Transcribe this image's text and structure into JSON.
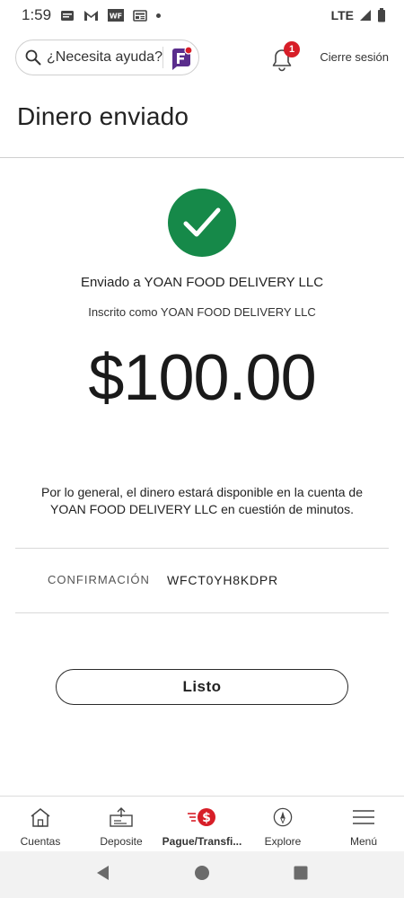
{
  "status_bar": {
    "time": "1:59",
    "network": "LTE",
    "notification_icons": [
      "message-icon",
      "gmail-icon",
      "wf-icon",
      "news-icon",
      "dot-icon"
    ]
  },
  "header": {
    "search_placeholder": "¿Necesita ayuda?",
    "notification_count": "1",
    "signout_label": "Cierre sesión"
  },
  "page": {
    "title": "Dinero enviado",
    "sent_to": "Enviado a YOAN FOOD DELIVERY LLC",
    "enrolled_as": "Inscrito como YOAN FOOD DELIVERY LLC",
    "amount": "$100.00",
    "note": "Por lo general, el dinero estará disponible en la cuenta de YOAN FOOD DELIVERY LLC en cuestión de minutos.",
    "confirmation_label": "CONFIRMACIÓN",
    "confirmation_value": "WFCT0YH8KDPR",
    "done_label": "Listo"
  },
  "bottom_nav": {
    "items": [
      {
        "label": "Cuentas",
        "icon": "house-icon"
      },
      {
        "label": "Deposite",
        "icon": "deposit-icon"
      },
      {
        "label": "Pague/Transfi...",
        "icon": "pay-transfer-icon"
      },
      {
        "label": "Explore",
        "icon": "compass-icon"
      },
      {
        "label": "Menú",
        "icon": "hamburger-icon"
      }
    ],
    "active_index": 2
  },
  "colors": {
    "success_green": "#168949",
    "accent_red": "#d71e28",
    "chat_purple": "#5a2d8c"
  }
}
